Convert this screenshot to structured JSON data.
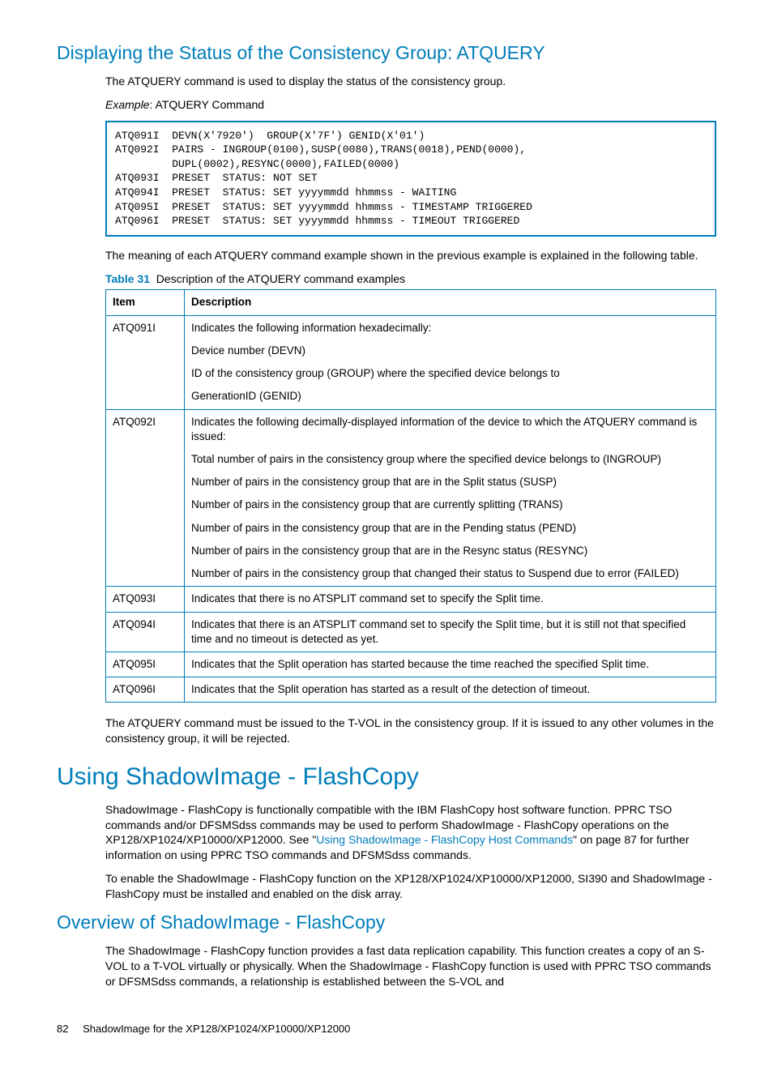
{
  "h2_1": "Displaying the Status of the Consistency Group: ATQUERY",
  "p1": "The ATQUERY command is used to display the status of the consistency group.",
  "example_label": "Example",
  "example_rest": ": ATQUERY Command",
  "code": "ATQ091I  DEVN(X'7920')  GROUP(X'7F') GENID(X'01')\nATQ092I  PAIRS - INGROUP(0100),SUSP(0080),TRANS(0018),PEND(0000),\n         DUPL(0002),RESYNC(0000),FAILED(0000)\nATQ093I  PRESET  STATUS: NOT SET\nATQ094I  PRESET  STATUS: SET yyyymmdd hhmmss - WAITING\nATQ095I  PRESET  STATUS: SET yyyymmdd hhmmss - TIMESTAMP TRIGGERED\nATQ096I  PRESET  STATUS: SET yyyymmdd hhmmss - TIMEOUT TRIGGERED",
  "p2": "The meaning of each ATQUERY command example shown in the previous example is explained in the following table.",
  "table_label": "Table 31",
  "table_caption": "Description of the ATQUERY command examples",
  "th_item": "Item",
  "th_desc": "Description",
  "rows": [
    {
      "item": "ATQ091I",
      "desc": [
        "Indicates the following information hexadecimally:",
        "Device number (DEVN)",
        "ID of the consistency group (GROUP) where the specified device belongs to",
        "GenerationID (GENID)"
      ]
    },
    {
      "item": "ATQ092I",
      "desc": [
        "Indicates the following decimally-displayed information of the device to which the ATQUERY command is issued:",
        "Total number of pairs in the consistency group where the specified device belongs to (INGROUP)",
        "Number of pairs in the consistency group that are in the Split status (SUSP)",
        "Number of pairs in the consistency group that are currently splitting (TRANS)",
        "Number of pairs in the consistency group that are in the Pending status (PEND)",
        "Number of pairs in the consistency group that are in the Resync status (RESYNC)",
        "Number of pairs in the consistency group that changed their status to Suspend due to error (FAILED)"
      ]
    },
    {
      "item": "ATQ093I",
      "desc": [
        "Indicates that there is no ATSPLIT command set to specify the Split time."
      ]
    },
    {
      "item": "ATQ094I",
      "desc": [
        "Indicates that there is an ATSPLIT command set to specify the Split time, but it is still not that specified time and no timeout is detected as yet."
      ]
    },
    {
      "item": "ATQ095I",
      "desc": [
        "Indicates that the Split operation has started because the time reached the specified Split time."
      ]
    },
    {
      "item": "ATQ096I",
      "desc": [
        "Indicates that the Split operation has started as a result of the detection of timeout."
      ]
    }
  ],
  "p3": "The ATQUERY command must be issued to the T-VOL in the consistency group. If it is issued to any other volumes in the consistency group, it will be rejected.",
  "h1_2": "Using ShadowImage - FlashCopy",
  "p4_a": "ShadowImage - FlashCopy is functionally compatible with the IBM FlashCopy host software function. PPRC TSO commands and/or DFSMSdss commands may be used to perform ShadowImage - FlashCopy operations on the XP128/XP1024/XP10000/XP12000. See \"",
  "p4_link": "Using ShadowImage - FlashCopy Host Commands",
  "p4_b": "\" on page 87 for further information on using PPRC TSO commands and DFSMSdss commands.",
  "p5": "To enable the ShadowImage - FlashCopy function on the XP128/XP1024/XP10000/XP12000, SI390 and ShadowImage - FlashCopy must be installed and enabled on the disk array.",
  "h2_3": "Overview of ShadowImage - FlashCopy",
  "p6": "The ShadowImage - FlashCopy function provides a fast data replication capability. This function creates a copy of an S-VOL to a T-VOL virtually or physically. When the ShadowImage - FlashCopy function is used with PPRC TSO commands or DFSMSdss commands, a relationship is established between the S-VOL and",
  "footer_page": "82",
  "footer_text": "ShadowImage for the XP128/XP1024/XP10000/XP12000"
}
